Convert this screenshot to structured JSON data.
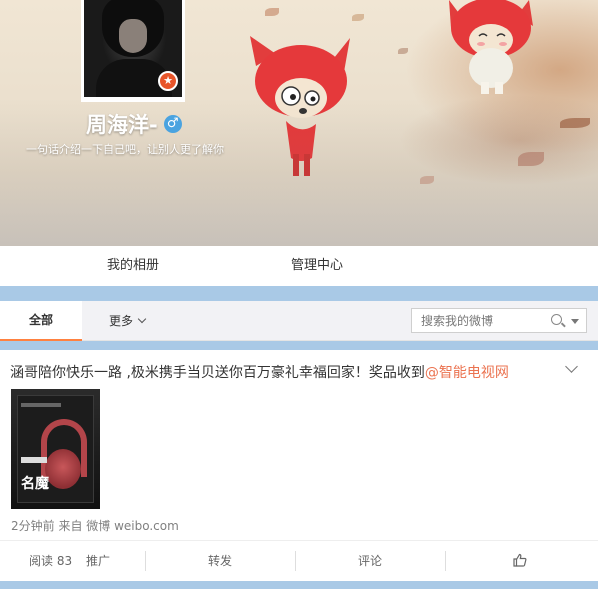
{
  "profile": {
    "name": "周海洋-",
    "bio": "一句话介绍一下自己吧，让别人更了解你",
    "gender_icon": "male-icon",
    "badge_icon": "star-badge-icon"
  },
  "profile_nav": {
    "items": [
      {
        "label": "我的相册"
      },
      {
        "label": "管理中心"
      }
    ]
  },
  "feed_tabs": {
    "all_label": "全部",
    "more_label": "更多",
    "search_placeholder": "搜索我的微博"
  },
  "post": {
    "text": "涵哥陪你快乐一路 ,极米携手当贝送你百万豪礼幸福回家！奖品收到",
    "mention": "@智能电视网",
    "image_brand_text": "名魔",
    "meta": "2分钟前 来自 微博 weibo.com",
    "actions": {
      "reads": "阅读 83",
      "promote": "推广",
      "repost": "转发",
      "comment": "评论"
    }
  },
  "colors": {
    "accent": "#ff8140",
    "mention": "#eb7350",
    "page_bg": "#a9c9e6"
  }
}
